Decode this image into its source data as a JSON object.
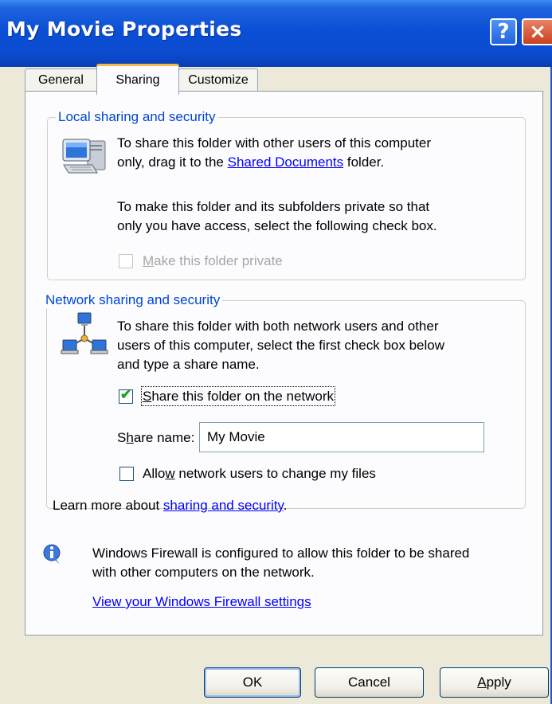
{
  "window": {
    "title": "My Movie Properties"
  },
  "titlebar": {
    "help_glyph": "?",
    "close_glyph": "×"
  },
  "tabs": [
    {
      "label": "General"
    },
    {
      "label": "Sharing",
      "active": true
    },
    {
      "label": "Customize"
    }
  ],
  "local": {
    "legend": "Local sharing and security",
    "line1": "To share this folder with other users of this computer",
    "line2_prefix": "only, drag it to the ",
    "line2_link": "Shared Documents",
    "line2_suffix": " folder.",
    "line3": "To make this folder and its subfolders private so that",
    "line4": "only you have access, select the following check box.",
    "private_checkbox": {
      "accel": "M",
      "rest": "ake this folder private",
      "checked": false,
      "enabled": false
    }
  },
  "network": {
    "legend": "Network sharing and security",
    "line1": "To share this folder with both network users and other",
    "line2": "users of this computer, select the first check box below",
    "line3": "and type a share name.",
    "share_checkbox": {
      "accel": "S",
      "rest": "hare this folder on the network",
      "checked": true
    },
    "share_name": {
      "label_pre": "S",
      "label_accel": "h",
      "label_post": "are name:",
      "value": "My Movie"
    },
    "allow_checkbox": {
      "pre": "Allo",
      "accel": "w",
      "post": " network users to change my files",
      "checked": false
    },
    "learn_prefix": "Learn more about ",
    "learn_link": "sharing and security",
    "learn_suffix": "."
  },
  "firewall": {
    "line1": "Windows Firewall is configured to allow this folder to be shared",
    "line2": "with other computers on the network.",
    "link": "View your Windows Firewall settings"
  },
  "buttons": {
    "ok": "OK",
    "cancel": "Cancel",
    "apply_accel": "A",
    "apply_rest": "pply"
  },
  "colors": {
    "title_bar": "#0a4fd6",
    "group_legend": "#0046d5",
    "link": "#0000ff",
    "dialog_face": "#ece9d8"
  },
  "icons": {
    "local": "computer-icon",
    "network": "network-icon",
    "info": "info-icon",
    "check": "check-icon"
  }
}
